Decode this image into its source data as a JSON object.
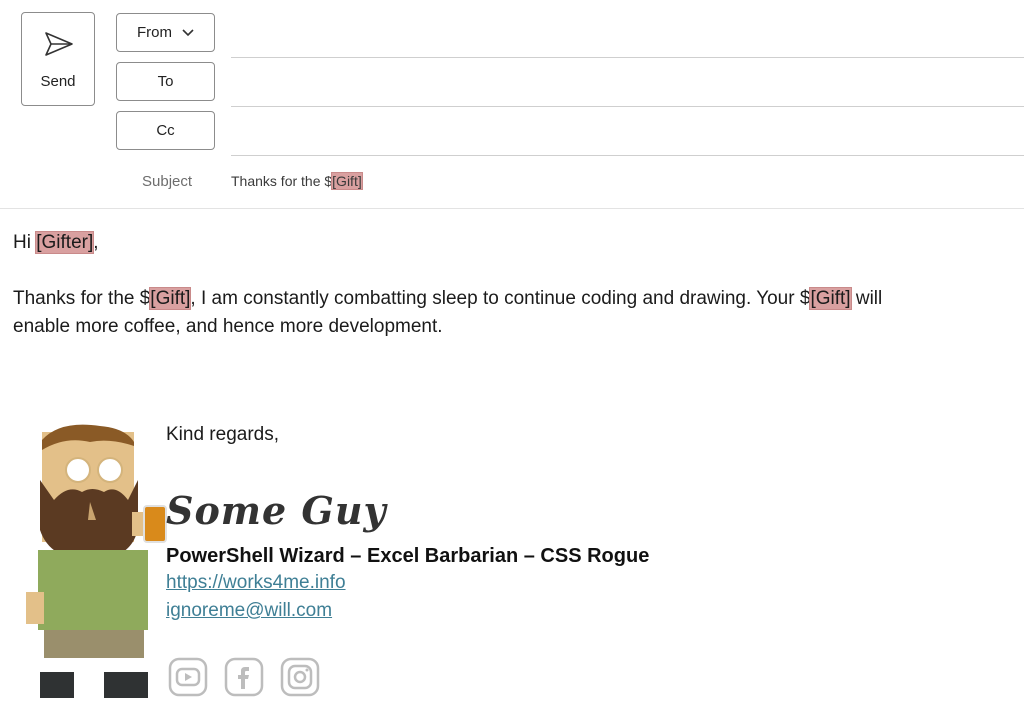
{
  "compose": {
    "send_label": "Send",
    "from_label": "From",
    "to_label": "To",
    "cc_label": "Cc",
    "subject_label": "Subject",
    "subject_prefix": "Thanks for the $",
    "subject_token": "[Gift]"
  },
  "body": {
    "greeting_prefix": "Hi ",
    "gifter_token": "[Gifter]",
    "greeting_suffix": ",",
    "line1_prefix": "Thanks for the $",
    "gift_token": "[Gift]",
    "line1_middle": ", I am constantly combatting sleep to continue coding and drawing. Your $",
    "line1_suffix": " will",
    "line2": "enable more coffee, and hence more development."
  },
  "signature": {
    "closing": "Kind regards,",
    "name": "Some Guy",
    "title": "PowerShell Wizard – Excel Barbarian – CSS Rogue",
    "website": "https://works4me.info",
    "email": "ignoreme@will.com",
    "social_icons": [
      "youtube-icon",
      "facebook-icon",
      "instagram-icon"
    ]
  },
  "colors": {
    "placeholder_highlight": "#d9a0a0",
    "link": "#3f7f95"
  }
}
